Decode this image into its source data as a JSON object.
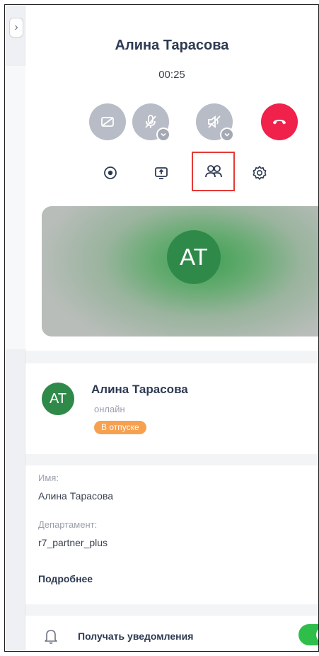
{
  "colors": {
    "accent_green": "#2f8a4a",
    "hangup_red": "#f0214b",
    "control_grey": "#b8bcc6",
    "vacation_orange": "#f6a050",
    "toggle_green": "#2fbe4a",
    "highlight_red": "#e53935"
  },
  "window": {
    "expand_icon": "chevron-right-icon",
    "collapse_icon": "collapse-arrows-icon",
    "minimize_icon": "minimize-icon"
  },
  "call": {
    "caller_name": "Алина Тарасова",
    "timer": "00:25",
    "controls": [
      {
        "name": "camera-off-button",
        "icon": "camera-off-icon"
      },
      {
        "name": "microphone-off-button",
        "icon": "microphone-off-icon"
      },
      {
        "name": "speaker-off-button",
        "icon": "speaker-off-icon"
      },
      {
        "name": "hang-up-button",
        "icon": "phone-hangup-icon"
      }
    ],
    "tools": [
      {
        "name": "record-button",
        "icon": "record-icon"
      },
      {
        "name": "screen-share-button",
        "icon": "screen-share-icon"
      },
      {
        "name": "participants-button",
        "icon": "participants-icon",
        "highlighted": true
      },
      {
        "name": "settings-button",
        "icon": "gear-icon"
      }
    ],
    "video_avatar_initials": "AT"
  },
  "profile": {
    "avatar_initials": "AT",
    "name": "Алина Тарасова",
    "status": "онлайн",
    "badge": "В отпуске"
  },
  "info": {
    "name_label": "Имя:",
    "name_value": "Алина Тарасова",
    "department_label": "Департамент:",
    "department_value": "r7_partner_plus",
    "more_link": "Подробнее"
  },
  "notifications": {
    "label": "Получать уведомления",
    "enabled": true,
    "icon": "bell-icon"
  }
}
